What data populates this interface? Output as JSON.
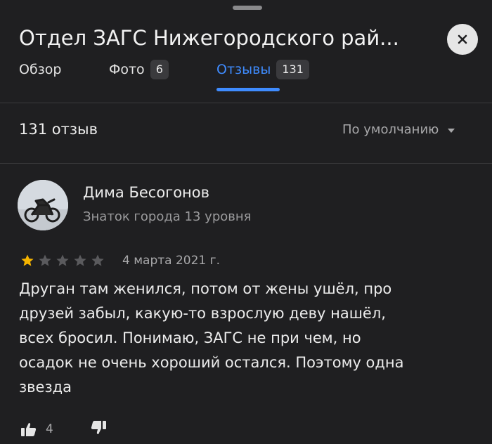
{
  "header": {
    "title": "Отдел ЗАГС Нижегородского рай...",
    "close_icon": "close-icon"
  },
  "tabs": [
    {
      "label": "Обзор",
      "count": null
    },
    {
      "label": "Фото",
      "count": "6"
    },
    {
      "label": "Отзывы",
      "count": "131",
      "active": true
    }
  ],
  "reviews_summary": {
    "count_label": "131 отзыв",
    "sort_label": "По умолчанию"
  },
  "review": {
    "author_name": "Дима Бесогонов",
    "author_level": "Знаток города 13 уровня",
    "rating": 1,
    "max_rating": 5,
    "date": "4 марта 2021 г.",
    "text_lines": [
      "Друган там женился, потом от жены ушёл, про",
      "друзей забыл, какую-то взрослую деву нашёл,",
      "всех бросил. Понимаю, ЗАГС не при чем, но",
      "осадок не очень хороший остался. Поэтому одна",
      "звезда"
    ],
    "likes": "4"
  },
  "colors": {
    "background": "#1f1f21",
    "accent": "#3f8cff",
    "star_filled": "#f5b400",
    "star_empty": "#5a5a5d",
    "muted_text": "#a8a8aa"
  },
  "icons": {
    "like": "thumbs-up-icon",
    "dislike": "thumbs-down-icon",
    "sort": "caret-down-icon"
  }
}
